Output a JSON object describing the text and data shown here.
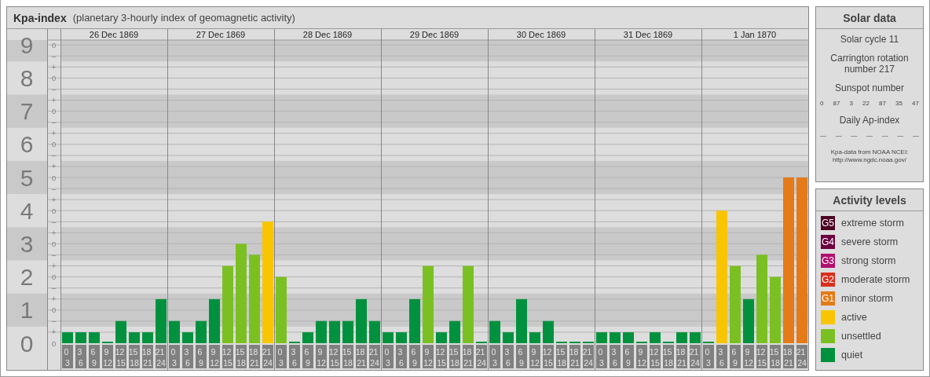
{
  "header": {
    "title": "Kpa-index",
    "subtitle": "(planetary 3-hourly index of geomagnetic activity)"
  },
  "chart": {
    "days": [
      {
        "date": "26 Dec 1869"
      },
      {
        "date": "27 Dec 1869"
      },
      {
        "date": "28 Dec 1869"
      },
      {
        "date": "29 Dec 1869"
      },
      {
        "date": "30 Dec 1869"
      },
      {
        "date": "31 Dec 1869"
      },
      {
        "date": "1 Jan 1870"
      }
    ],
    "y_minor_labels": [
      [
        {
          "kind": "on",
          "text": "o"
        },
        {
          "kind": "below",
          "text": "–"
        }
      ],
      [
        {
          "kind": "above",
          "text": "+"
        },
        {
          "kind": "on",
          "text": "o"
        },
        {
          "kind": "below",
          "text": "–"
        }
      ],
      [
        {
          "kind": "above",
          "text": "+"
        },
        {
          "kind": "on",
          "text": "o"
        },
        {
          "kind": "below",
          "text": "–"
        }
      ],
      [
        {
          "kind": "above",
          "text": "+"
        },
        {
          "kind": "on",
          "text": "o"
        },
        {
          "kind": "below",
          "text": "–"
        }
      ],
      [
        {
          "kind": "above",
          "text": "+"
        },
        {
          "kind": "on",
          "text": "o"
        },
        {
          "kind": "below",
          "text": "–"
        }
      ],
      [
        {
          "kind": "above",
          "text": "+"
        },
        {
          "kind": "on",
          "text": "o"
        },
        {
          "kind": "below",
          "text": "–"
        }
      ],
      [
        {
          "kind": "above",
          "text": "+"
        },
        {
          "kind": "on",
          "text": "o"
        },
        {
          "kind": "below",
          "text": "–"
        }
      ],
      [
        {
          "kind": "above",
          "text": "+"
        },
        {
          "kind": "on",
          "text": "o"
        },
        {
          "kind": "below",
          "text": "–"
        }
      ],
      [
        {
          "kind": "above",
          "text": "+"
        },
        {
          "kind": "on",
          "text": "o"
        },
        {
          "kind": "below",
          "text": "–"
        }
      ],
      [
        {
          "kind": "above",
          "text": "+"
        },
        {
          "kind": "on",
          "text": "o"
        }
      ]
    ],
    "chart_data": {
      "type": "bar",
      "grid": true,
      "ylim": [
        0,
        9
      ],
      "yticks": [
        0,
        1,
        2,
        3,
        4,
        5,
        6,
        7,
        8,
        9
      ],
      "categories": [
        "0 3",
        "3 6",
        "6 9",
        "9 12",
        "12 15",
        "15 18",
        "18 21",
        "21 24",
        "0 3",
        "3 6",
        "6 9",
        "9 12",
        "12 15",
        "15 18",
        "18 21",
        "21 24",
        "0 3",
        "3 6",
        "6 9",
        "9 12",
        "12 15",
        "15 18",
        "18 21",
        "21 24",
        "0 3",
        "3 6",
        "6 9",
        "9 12",
        "12 15",
        "15 18",
        "18 21",
        "21 24",
        "0 3",
        "3 6",
        "6 9",
        "9 12",
        "12 15",
        "15 18",
        "18 21",
        "21 24",
        "0 3",
        "3 6",
        "6 9",
        "9 12",
        "12 15",
        "15 18",
        "18 21",
        "21 24",
        "0 3",
        "3 6",
        "6 9",
        "9 12",
        "12 15",
        "15 18",
        "18 21",
        "21 24"
      ],
      "series": [
        {
          "color": "#00913f",
          "values": [
            0.33,
            0.33,
            0.33,
            0,
            0.67,
            0.33,
            0.33,
            1.33,
            0.67,
            0.33,
            0.67,
            1.33,
            null,
            null,
            null,
            null,
            null,
            0,
            0.33,
            0.67,
            0.67,
            0.67,
            1.33,
            0.67,
            0.33,
            0.33,
            1.33,
            null,
            0.33,
            0.67,
            null,
            0,
            0.67,
            0.33,
            1.33,
            0.33,
            0.67,
            0,
            0,
            0,
            0.33,
            0.33,
            0.33,
            0,
            0.33,
            0,
            0.33,
            0.33,
            0,
            null,
            null,
            1.33,
            null,
            null,
            null,
            null
          ]
        },
        {
          "color": "#7bc023",
          "values": [
            null,
            null,
            null,
            null,
            null,
            null,
            null,
            null,
            null,
            null,
            null,
            null,
            2.33,
            3,
            2.67,
            null,
            2,
            null,
            null,
            null,
            null,
            null,
            null,
            null,
            null,
            null,
            null,
            2.33,
            null,
            null,
            2.33,
            null,
            null,
            null,
            null,
            null,
            null,
            null,
            null,
            null,
            null,
            null,
            null,
            null,
            null,
            null,
            null,
            null,
            null,
            null,
            2.33,
            null,
            2.67,
            2,
            null,
            null
          ]
        },
        {
          "color": "#f8c500",
          "values": [
            null,
            null,
            null,
            null,
            null,
            null,
            null,
            null,
            null,
            null,
            null,
            null,
            null,
            null,
            null,
            3.67,
            null,
            null,
            null,
            null,
            null,
            null,
            null,
            null,
            null,
            null,
            null,
            null,
            null,
            null,
            null,
            null,
            null,
            null,
            null,
            null,
            null,
            null,
            null,
            null,
            null,
            null,
            null,
            null,
            null,
            null,
            null,
            null,
            null,
            4,
            null,
            null,
            null,
            null,
            null,
            null
          ]
        },
        {
          "color": "#e57a18",
          "values": [
            null,
            null,
            null,
            null,
            null,
            null,
            null,
            null,
            null,
            null,
            null,
            null,
            null,
            null,
            null,
            null,
            null,
            null,
            null,
            null,
            null,
            null,
            null,
            null,
            null,
            null,
            null,
            null,
            null,
            null,
            null,
            null,
            null,
            null,
            null,
            null,
            null,
            null,
            null,
            null,
            null,
            null,
            null,
            null,
            null,
            null,
            null,
            null,
            null,
            null,
            null,
            null,
            null,
            null,
            5,
            5
          ]
        }
      ]
    }
  },
  "solar_data": {
    "title": "Solar data",
    "solar_cycle": "Solar cycle 11",
    "carrington": "Carrington rotation number 217",
    "sunspot_title": "Sunspot number",
    "sunspots": [
      "0",
      "87",
      "3",
      "22",
      "87",
      "35",
      "47"
    ],
    "ap_title": "Daily Ap-index",
    "ap_values": [
      "—",
      "—",
      "—",
      "—",
      "—",
      "—",
      "—"
    ],
    "source": "Kpa-data from NOAA NCEI:",
    "source_url": "http://www.ngdc.noaa.gov/"
  },
  "activity_levels": {
    "title": "Activity levels",
    "items": [
      {
        "badge": "G5",
        "label": "extreme storm",
        "color": "#4c0022"
      },
      {
        "badge": "G4",
        "label": "severe storm",
        "color": "#6c0040"
      },
      {
        "badge": "G3",
        "label": "strong storm",
        "color": "#b21070"
      },
      {
        "badge": "G2",
        "label": "moderate storm",
        "color": "#da2f1d"
      },
      {
        "badge": "G1",
        "label": "minor storm",
        "color": "#e57a18"
      },
      {
        "label": "active",
        "color": "#f8c500"
      },
      {
        "label": "unsettled",
        "color": "#7bc023"
      },
      {
        "label": "quiet",
        "color": "#00913f"
      }
    ]
  }
}
